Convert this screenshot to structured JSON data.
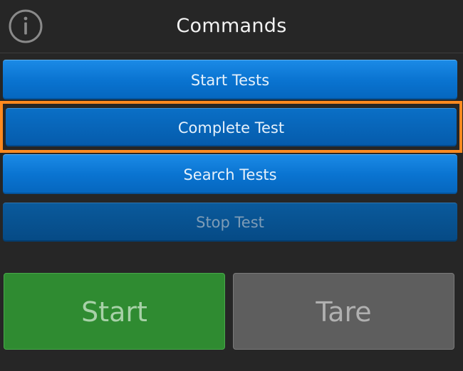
{
  "header": {
    "title": "Commands",
    "info_icon": "info-circle-icon"
  },
  "commands": {
    "start_tests": "Start Tests",
    "complete_test": "Complete Test",
    "search_tests": "Search Tests",
    "stop_test": "Stop Test"
  },
  "actions": {
    "start": "Start",
    "tare": "Tare"
  },
  "colors": {
    "background": "#262626",
    "button_blue": "#0a74d1",
    "highlight_orange": "#ff8a1f",
    "start_green": "#2f8b31",
    "tare_gray": "#5e5e5e"
  }
}
